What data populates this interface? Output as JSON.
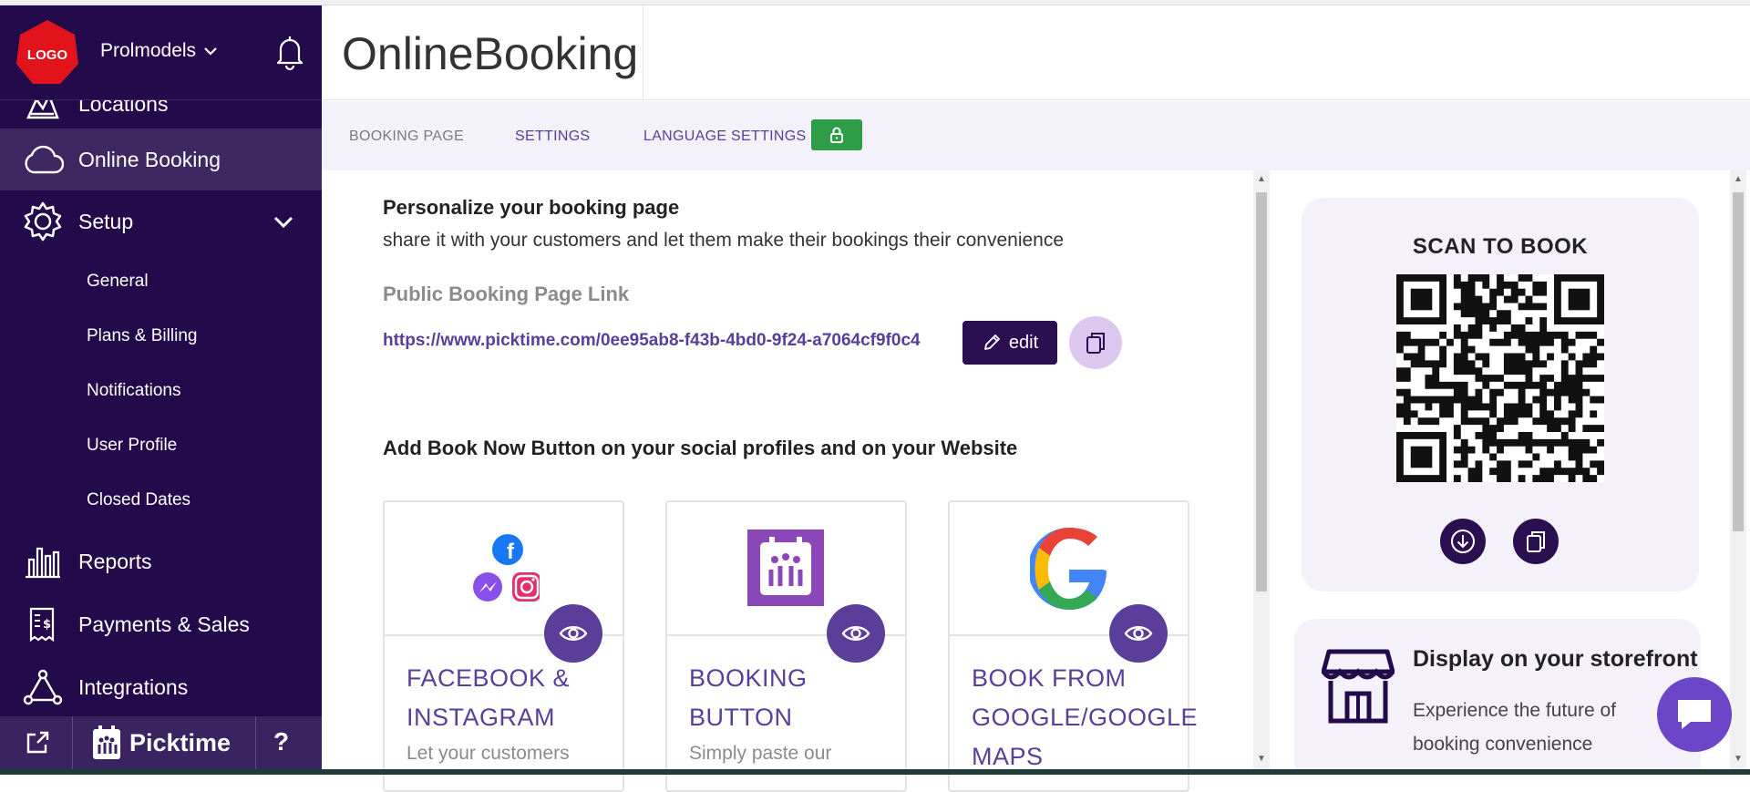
{
  "sidebar": {
    "logo_text": "LOGO",
    "org_name": "Prolmodels",
    "nav": {
      "locations": "Locations",
      "online_booking": "Online Booking",
      "setup": "Setup",
      "reports": "Reports",
      "payments": "Payments & Sales",
      "integrations": "Integrations"
    },
    "setup_items": [
      "General",
      "Plans & Billing",
      "Notifications",
      "User Profile",
      "Closed Dates"
    ],
    "footer": {
      "brand": "Picktime",
      "help": "?"
    }
  },
  "header": {
    "title": "OnlineBooking"
  },
  "tabs": {
    "booking_page": "BOOKING PAGE",
    "settings": "SETTINGS",
    "language_settings": "LANGUAGE SETTINGS"
  },
  "main": {
    "heading": "Personalize your booking page",
    "subtext": "share it with your customers and let them make their bookings their convenience",
    "link_label": "Public Booking Page Link",
    "link_url": "https://www.picktime.com/0ee95ab8-f43b-4bd0-9f24-a7064cf9f0c4",
    "edit_label": "edit",
    "social_heading": "Add Book Now Button on your social profiles and on your Website",
    "cards": [
      {
        "title": "FACEBOOK & INSTAGRAM",
        "desc": "Let your customers"
      },
      {
        "title": "BOOKING BUTTON",
        "desc": "Simply paste our"
      },
      {
        "title": "BOOK FROM GOOGLE/GOOGLE MAPS",
        "desc": ""
      }
    ]
  },
  "right_panel": {
    "scan_title": "SCAN TO BOOK",
    "storefront_title": "Display on your storefront",
    "storefront_text": "Experience the future of booking convenience"
  },
  "colors": {
    "sidebar_bg": "#230a4b",
    "accent": "#5a3e99",
    "lock_green": "#2e9d47",
    "panel_bg": "#f4f1fb",
    "chat": "#6c46c8"
  }
}
